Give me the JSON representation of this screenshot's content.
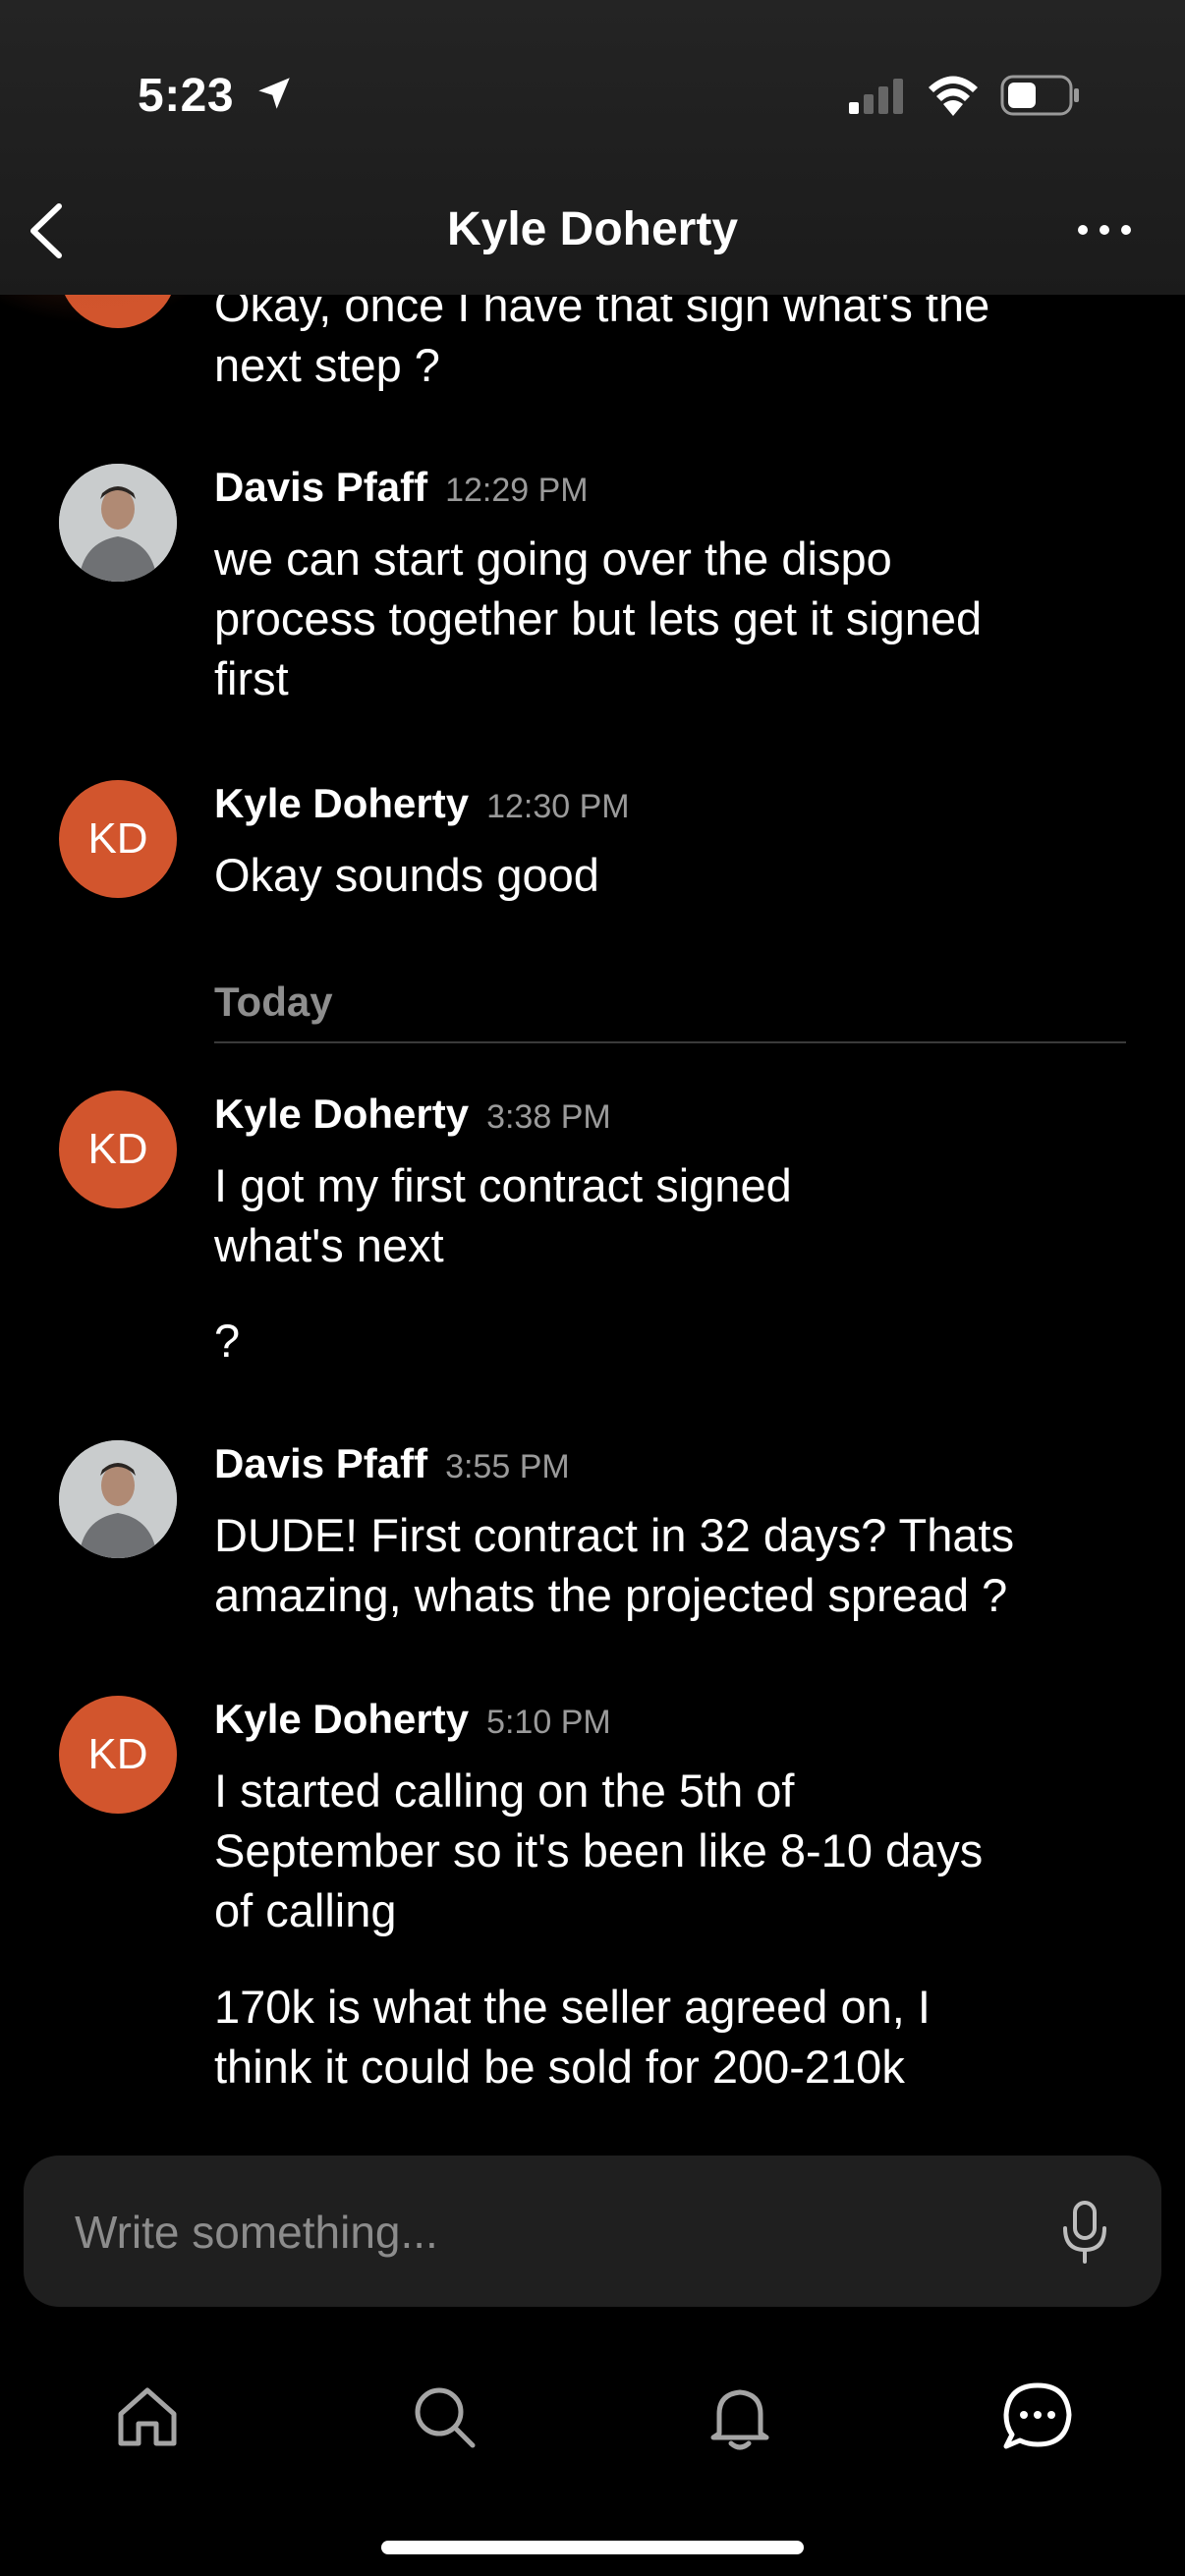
{
  "status_bar": {
    "time": "5:23"
  },
  "header": {
    "title": "Kyle Doherty"
  },
  "messages": [
    {
      "author": "",
      "time": "",
      "lines": [
        "Okay, once I have that sign what's the",
        "next step ?"
      ]
    },
    {
      "author": "Davis Pfaff",
      "time": "12:29 PM",
      "lines": [
        "we can start going over the dispo",
        "process together but lets get it signed",
        "first"
      ]
    },
    {
      "author": "Kyle Doherty",
      "initials": "KD",
      "time": "12:30 PM",
      "lines": [
        "Okay sounds good"
      ]
    },
    {
      "author": "Kyle Doherty",
      "initials": "KD",
      "time": "3:38 PM",
      "lines": [
        "I got my first contract signed",
        "what's next"
      ],
      "extra": "?"
    },
    {
      "author": "Davis Pfaff",
      "time": "3:55 PM",
      "lines": [
        "DUDE! First contract in 32 days? Thats",
        "amazing, whats the projected spread ?"
      ]
    },
    {
      "author": "Kyle Doherty",
      "initials": "KD",
      "time": "5:10 PM",
      "lines": [
        "I started calling on the 5th of",
        "September so it's been like 8-10 days",
        "of calling"
      ],
      "extra_lines": [
        "170k is what the seller agreed on, I",
        "think it could be sold for 200-210k"
      ]
    }
  ],
  "day_divider": "Today",
  "composer": {
    "placeholder": "Write something..."
  },
  "tabs": [
    "home-icon",
    "search-icon",
    "bell-icon",
    "chat-icon"
  ],
  "colors": {
    "avatar_kd": "#d2552d",
    "background": "#000000",
    "header": "#1f1f1f",
    "muted_text": "#9a9a9a"
  }
}
